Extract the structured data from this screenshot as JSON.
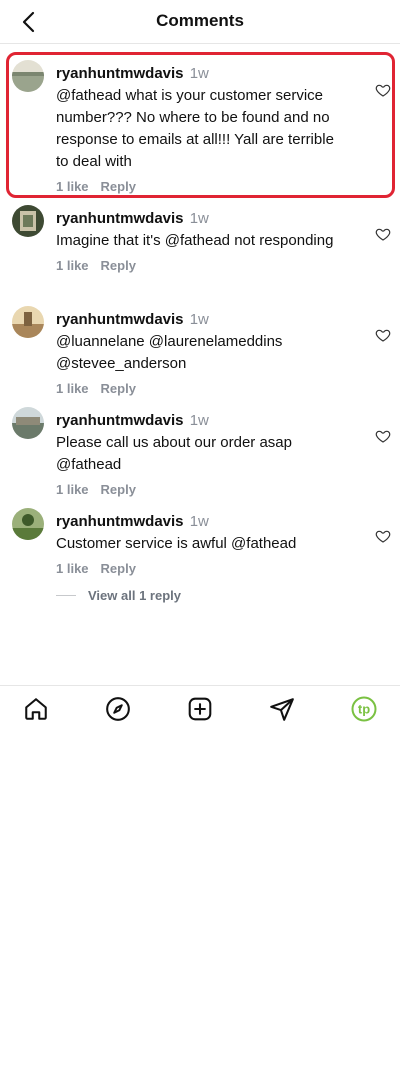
{
  "header": {
    "title": "Comments"
  },
  "comments": [
    {
      "username": "ryanhuntmwdavis",
      "time": "1w",
      "text": "@fathead what is your customer service number??? No where to be found and no response to emails at all!!! Yall are terrible to deal with",
      "likes": "1 like",
      "reply_label": "Reply",
      "avatar_colors": [
        "#9aa48d",
        "#d9d6c8"
      ]
    },
    {
      "username": "ryanhuntmwdavis",
      "time": "1w",
      "text": "Imagine that it's @fathead not responding",
      "likes": "1 like",
      "reply_label": "Reply",
      "avatar_colors": [
        "#4a5a3a",
        "#c9c2a8"
      ]
    },
    {
      "username": "ryanhuntmwdavis",
      "time": "1w",
      "text": "@luannelane @laurenelameddins @stevee_anderson",
      "likes": "1 like",
      "reply_label": "Reply",
      "avatar_colors": [
        "#a9865a",
        "#e9d7b0"
      ]
    },
    {
      "username": "ryanhuntmwdavis",
      "time": "1w",
      "text": "Please call us about our order asap @fathead",
      "likes": "1 like",
      "reply_label": "Reply",
      "avatar_colors": [
        "#6b7a6a",
        "#cfd8da"
      ]
    },
    {
      "username": "ryanhuntmwdavis",
      "time": "1w",
      "text": "Customer service is awful @fathead",
      "likes": "1 like",
      "reply_label": "Reply",
      "avatar_colors": [
        "#5a7a3a",
        "#9bb07a"
      ]
    }
  ],
  "view_replies": "View all 1 reply",
  "nav": {
    "items": [
      "home-icon",
      "explore-icon",
      "create-icon",
      "messages-icon",
      "profile-icon"
    ],
    "profile_initials": "tp",
    "profile_color": "#7ac142"
  },
  "colors": {
    "highlight": "#e02433",
    "muted": "#8a8f98"
  }
}
